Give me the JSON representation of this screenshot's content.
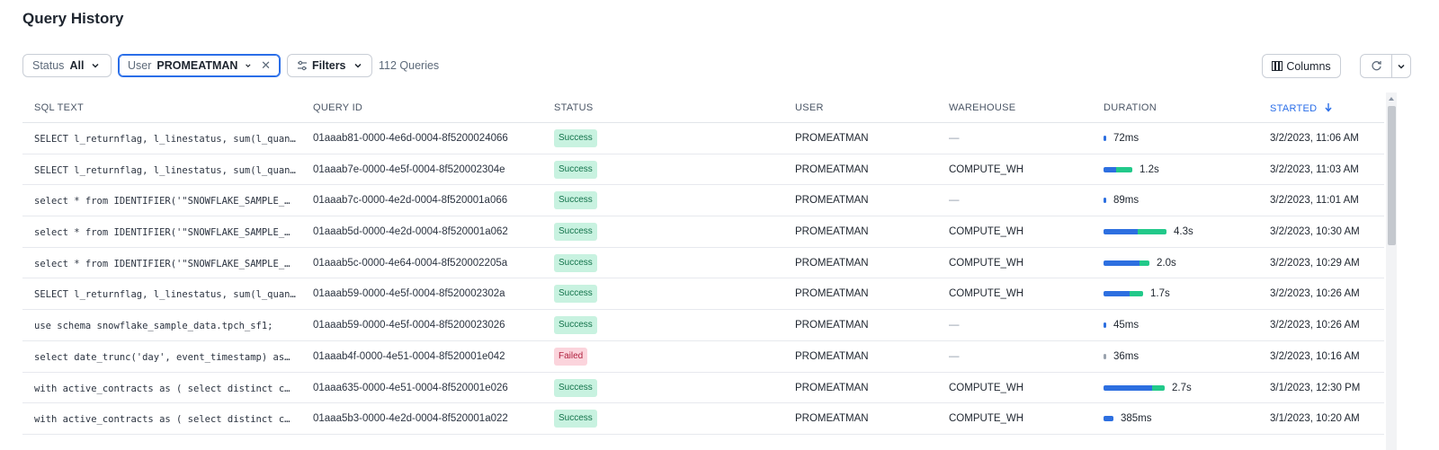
{
  "page": {
    "title": "Query History"
  },
  "toolbar": {
    "status": {
      "label": "Status",
      "value": "All"
    },
    "user": {
      "label": "User",
      "value": "PROMEATMAN"
    },
    "filters_label": "Filters",
    "query_count": "112 Queries",
    "columns_label": "Columns"
  },
  "table": {
    "headers": {
      "sql_text": "SQL TEXT",
      "query_id": "QUERY ID",
      "status": "STATUS",
      "user": "USER",
      "warehouse": "WAREHOUSE",
      "duration": "DURATION",
      "started": "STARTED"
    },
    "rows": [
      {
        "sql": "SELECT l_returnflag, l_linestatus, sum(l_quan…",
        "id": "01aaab81-0000-4e6d-0004-8f5200024066",
        "status": "Success",
        "user": "PROMEATMAN",
        "warehouse": "—",
        "duration": "72ms",
        "started": "3/2/2023, 11:06 AM",
        "bar_blue_fraction": 0.04,
        "bar_green_fraction": 0.0
      },
      {
        "sql": "SELECT l_returnflag, l_linestatus, sum(l_quan…",
        "id": "01aaab7e-0000-4e5f-0004-8f520002304e",
        "status": "Success",
        "user": "PROMEATMAN",
        "warehouse": "COMPUTE_WH",
        "duration": "1.2s",
        "started": "3/2/2023, 11:03 AM",
        "bar_blue_fraction": 0.2,
        "bar_green_fraction": 0.26
      },
      {
        "sql": "select * from IDENTIFIER('\"SNOWFLAKE_SAMPLE_…",
        "id": "01aaab7c-0000-4e2d-0004-8f520001a066",
        "status": "Success",
        "user": "PROMEATMAN",
        "warehouse": "—",
        "duration": "89ms",
        "started": "3/2/2023, 11:01 AM",
        "bar_blue_fraction": 0.04,
        "bar_green_fraction": 0.0
      },
      {
        "sql": "select * from IDENTIFIER('\"SNOWFLAKE_SAMPLE_…",
        "id": "01aaab5d-0000-4e2d-0004-8f520001a062",
        "status": "Success",
        "user": "PROMEATMAN",
        "warehouse": "COMPUTE_WH",
        "duration": "4.3s",
        "started": "3/2/2023, 10:30 AM",
        "bar_blue_fraction": 0.54,
        "bar_green_fraction": 0.46
      },
      {
        "sql": "select * from IDENTIFIER('\"SNOWFLAKE_SAMPLE_…",
        "id": "01aaab5c-0000-4e64-0004-8f520002205a",
        "status": "Success",
        "user": "PROMEATMAN",
        "warehouse": "COMPUTE_WH",
        "duration": "2.0s",
        "started": "3/2/2023, 10:29 AM",
        "bar_blue_fraction": 0.57,
        "bar_green_fraction": 0.16
      },
      {
        "sql": "SELECT l_returnflag, l_linestatus, sum(l_quan…",
        "id": "01aaab59-0000-4e5f-0004-8f520002302a",
        "status": "Success",
        "user": "PROMEATMAN",
        "warehouse": "COMPUTE_WH",
        "duration": "1.7s",
        "started": "3/2/2023, 10:26 AM",
        "bar_blue_fraction": 0.42,
        "bar_green_fraction": 0.22
      },
      {
        "sql": "use schema snowflake_sample_data.tpch_sf1;",
        "id": "01aaab59-0000-4e5f-0004-8f5200023026",
        "status": "Success",
        "user": "PROMEATMAN",
        "warehouse": "—",
        "duration": "45ms",
        "started": "3/2/2023, 10:26 AM",
        "bar_blue_fraction": 0.04,
        "bar_green_fraction": 0.0
      },
      {
        "sql": "select date_trunc('day', event_timestamp) as…",
        "id": "01aaab4f-0000-4e51-0004-8f520001e042",
        "status": "Failed",
        "user": "PROMEATMAN",
        "warehouse": "—",
        "duration": "36ms",
        "started": "3/2/2023, 10:16 AM",
        "bar_blue_fraction": 0.0,
        "bar_green_fraction": 0.0,
        "bar_gray_fraction": 0.04
      },
      {
        "sql": "with active_contracts as ( select distinct c…",
        "id": "01aaa635-0000-4e51-0004-8f520001e026",
        "status": "Success",
        "user": "PROMEATMAN",
        "warehouse": "COMPUTE_WH",
        "duration": "2.7s",
        "started": "3/1/2023, 12:30 PM",
        "bar_blue_fraction": 0.77,
        "bar_green_fraction": 0.2
      },
      {
        "sql": "with active_contracts as ( select distinct c…",
        "id": "01aaa5b3-0000-4e2d-0004-8f520001a022",
        "status": "Success",
        "user": "PROMEATMAN",
        "warehouse": "COMPUTE_WH",
        "duration": "385ms",
        "started": "3/1/2023, 10:20 AM",
        "bar_blue_fraction": 0.15,
        "bar_green_fraction": 0.0
      }
    ]
  },
  "colors": {
    "accent": "#2a6ee8",
    "success_bg": "#c8f2e0",
    "failed_bg": "#fbd4dc",
    "bar_blue": "#2d6fe0",
    "bar_green": "#22c98a"
  }
}
